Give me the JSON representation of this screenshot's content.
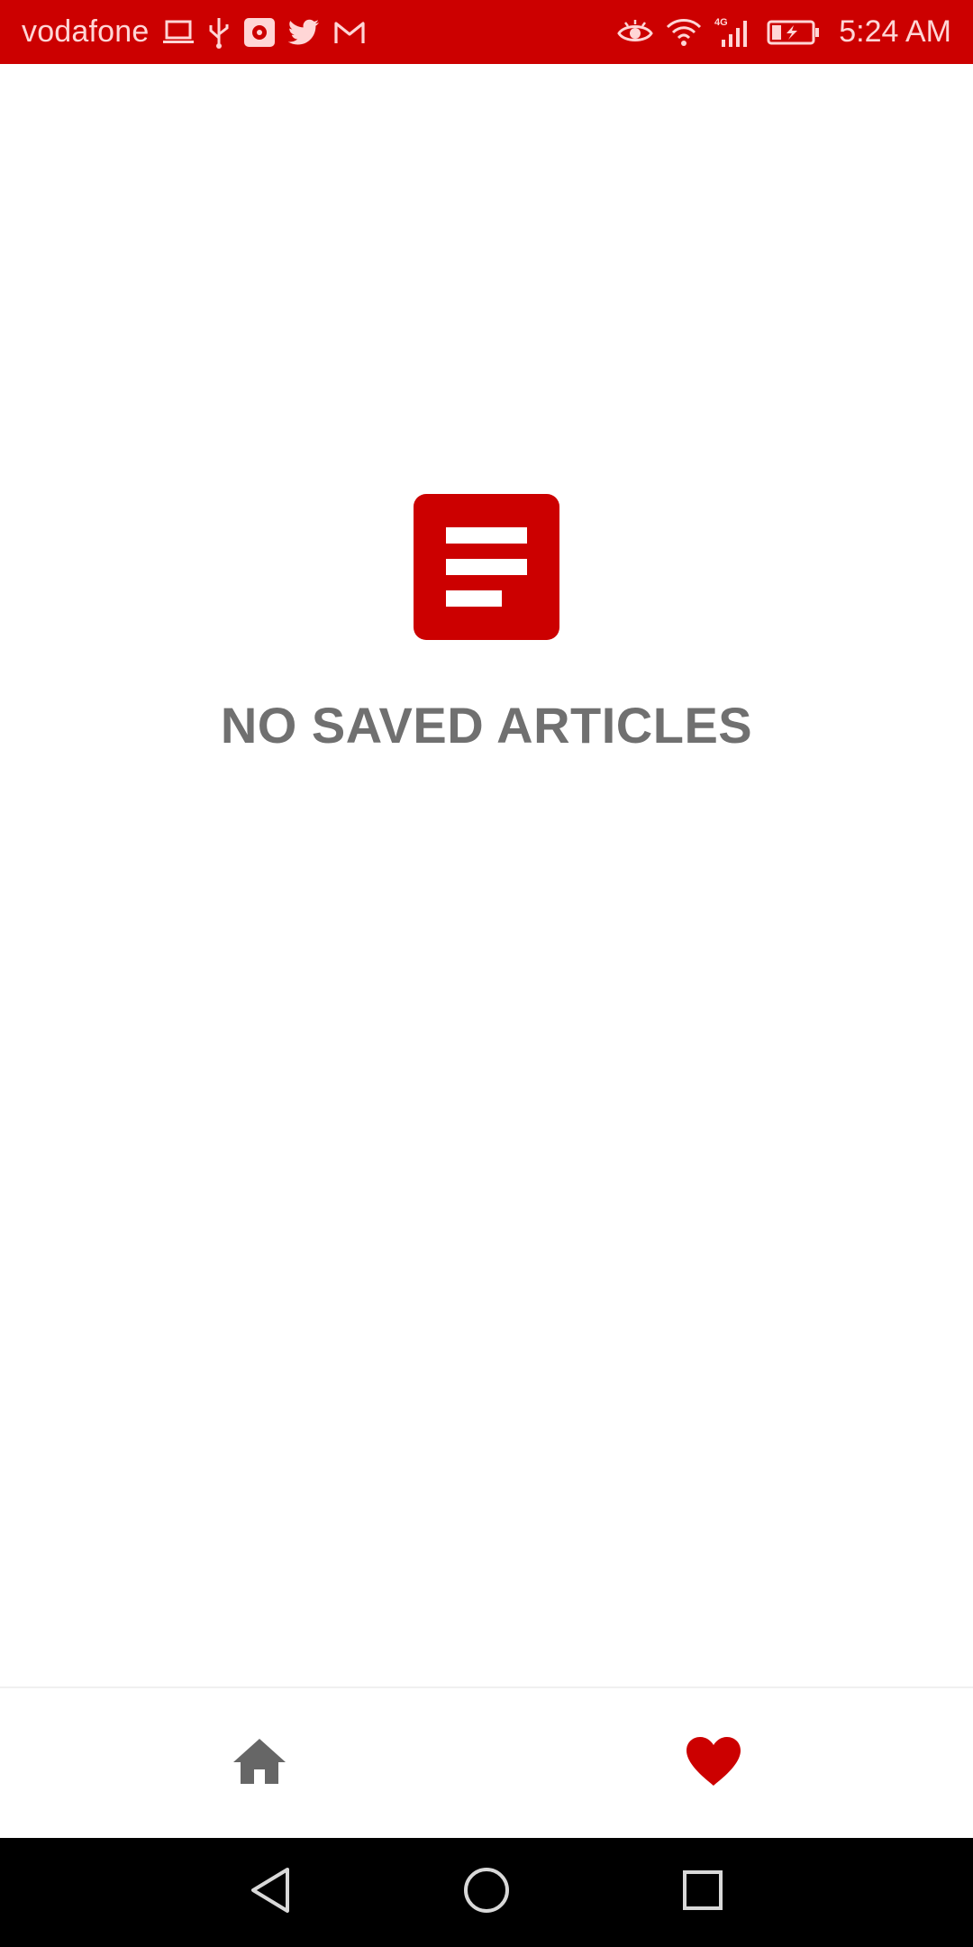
{
  "status_bar": {
    "carrier": "vodafone",
    "time": "5:24 AM",
    "left_icons": [
      "laptop-icon",
      "usb-icon",
      "app-badge-icon",
      "twitter-icon",
      "gmail-icon"
    ],
    "right_icons": [
      "eye-icon",
      "wifi-icon",
      "signal-4g-icon",
      "battery-charging-icon"
    ],
    "background_color": "#cc0000"
  },
  "empty_state": {
    "icon": "article-icon",
    "title": "NO SAVED ARTICLES",
    "icon_color": "#cc0000",
    "title_color": "#707070"
  },
  "bottom_nav": {
    "items": [
      {
        "icon": "home-icon",
        "active": false,
        "color": "#666666"
      },
      {
        "icon": "heart-icon",
        "active": true,
        "color": "#cc0000"
      }
    ]
  },
  "system_nav": {
    "buttons": [
      "back-icon",
      "home-circle-icon",
      "recents-icon"
    ]
  }
}
